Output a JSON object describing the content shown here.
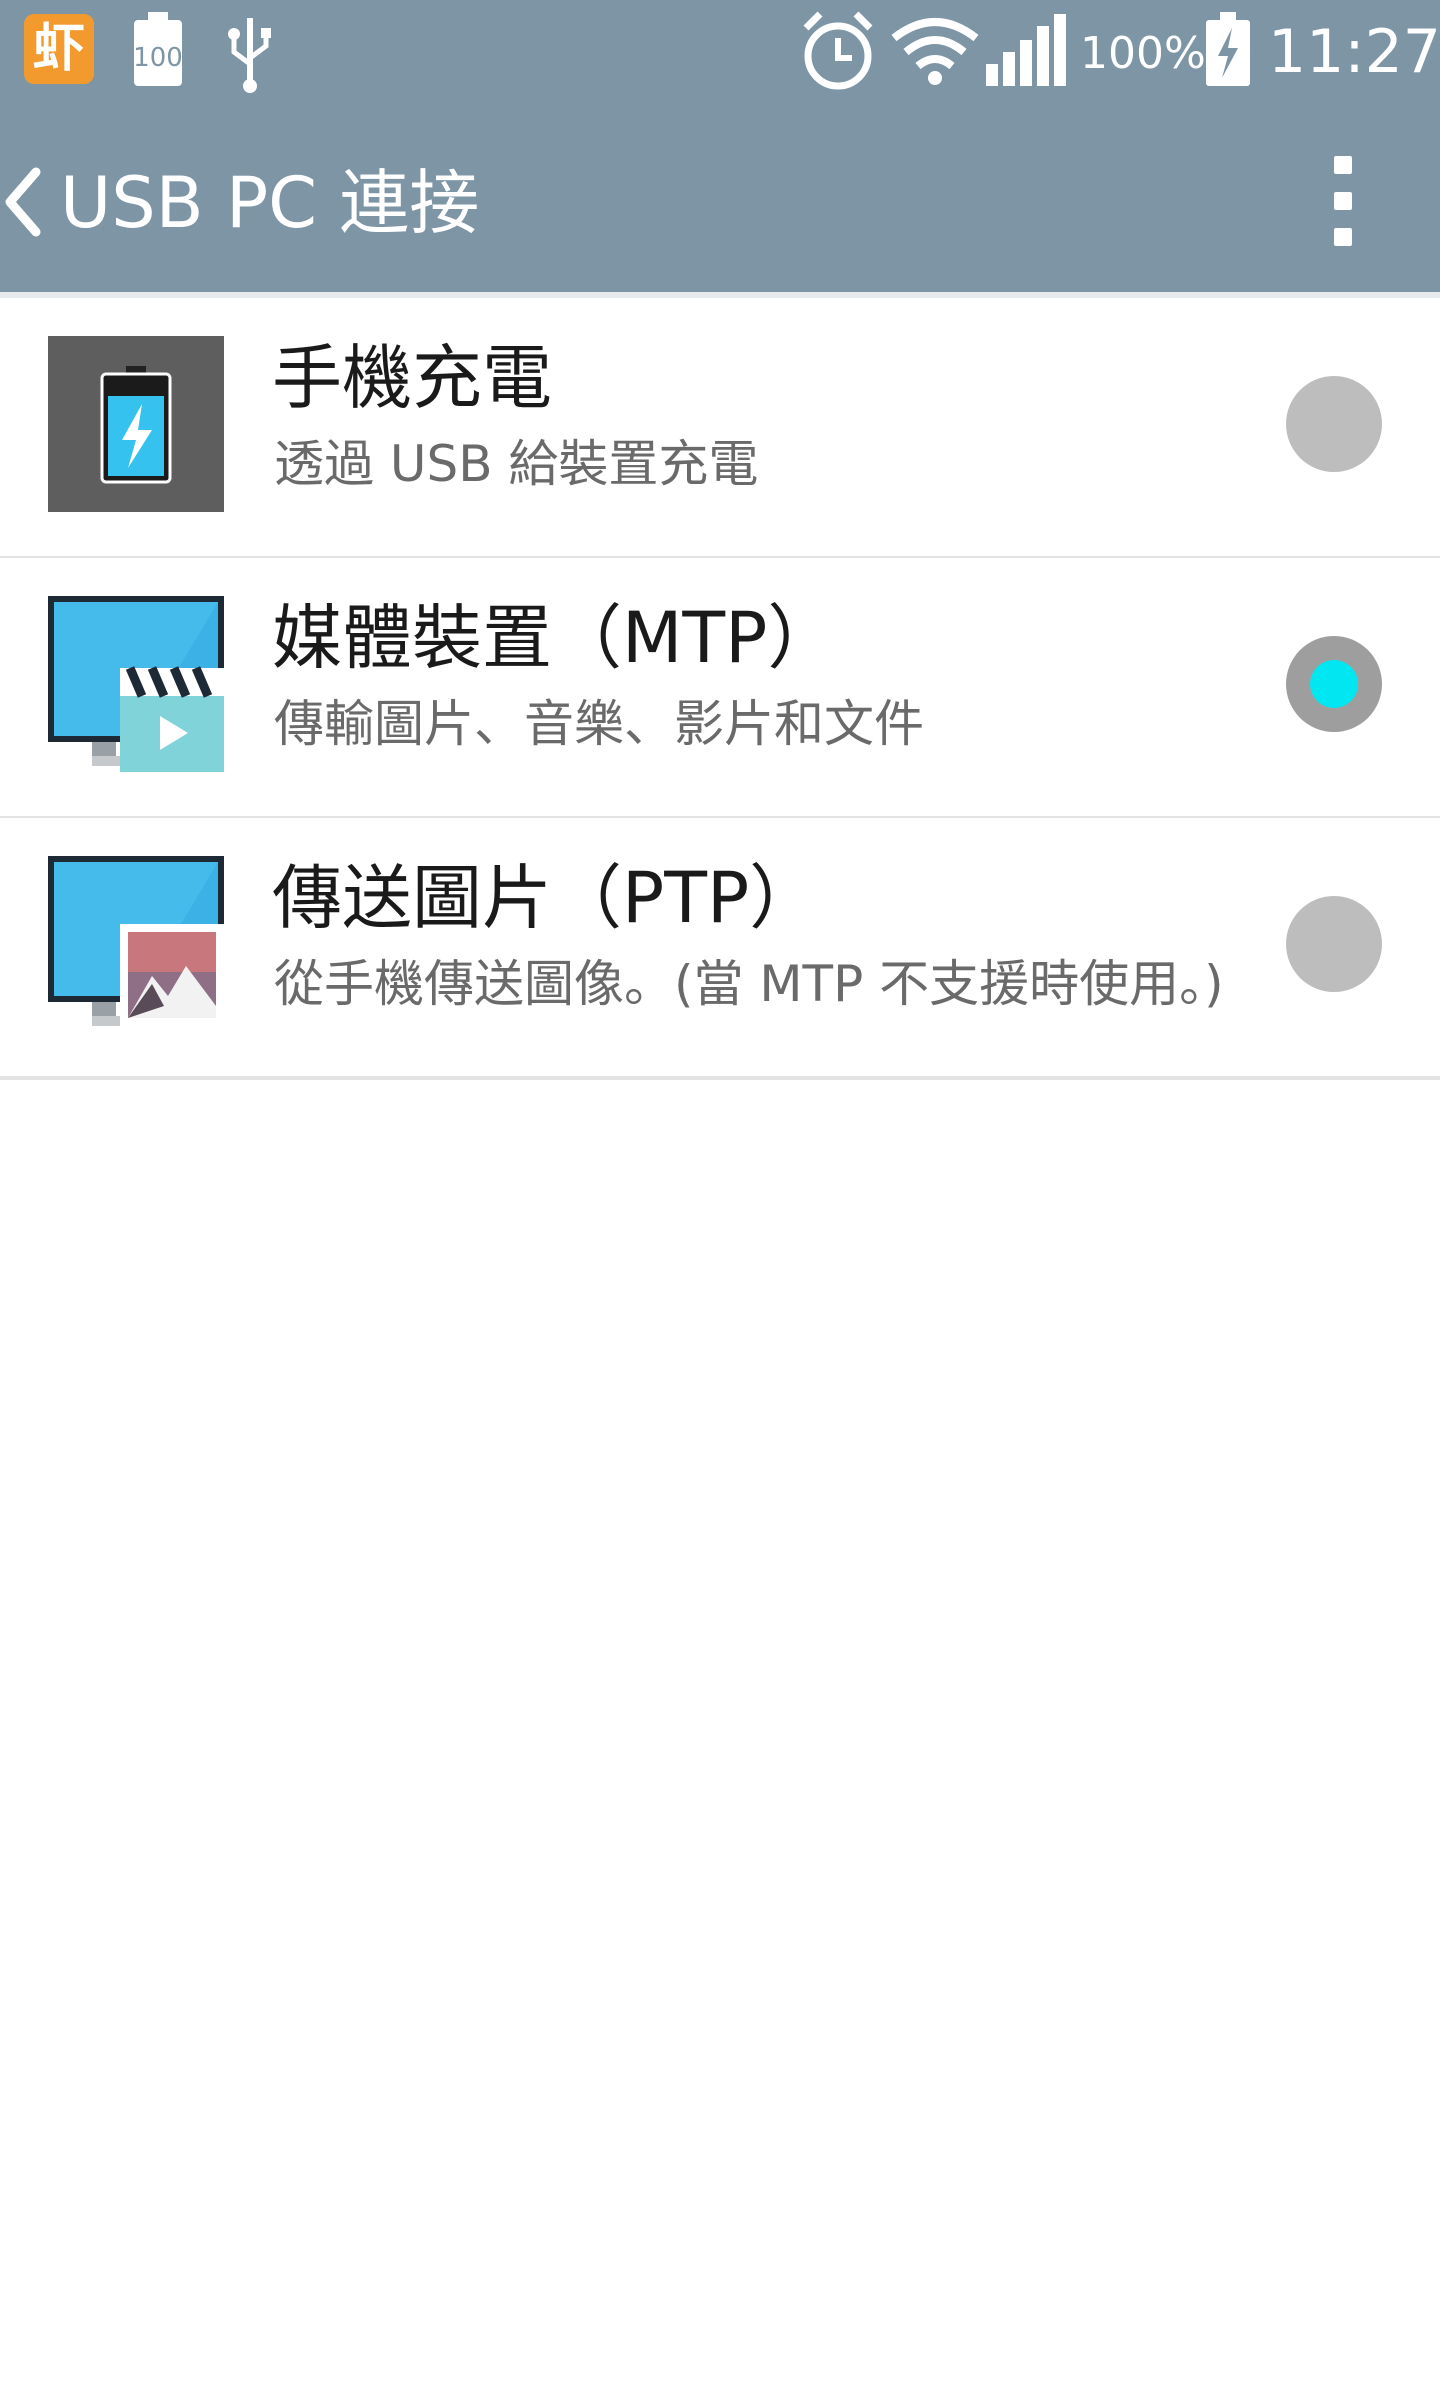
{
  "status_bar": {
    "app_badge": "虾",
    "battery_small": "100",
    "battery_percent": "100%",
    "time": "11:27"
  },
  "app_bar": {
    "title": "USB PC 連接"
  },
  "options": [
    {
      "title": "手機充電",
      "subtitle": "透過 USB 給裝置充電",
      "icon": "battery-charging-icon",
      "selected": false
    },
    {
      "title": "媒體裝置（MTP）",
      "subtitle": "傳輸圖片、音樂、影片和文件",
      "icon": "media-device-icon",
      "selected": true
    },
    {
      "title": "傳送圖片（PTP）",
      "subtitle": "從手機傳送圖像。(當 MTP 不支援時使用。)",
      "icon": "photo-transfer-icon",
      "selected": false
    }
  ],
  "colors": {
    "bar": "#7e95a5",
    "radio_on": "#00e7f2",
    "radio_off": "#bdbdbd"
  }
}
